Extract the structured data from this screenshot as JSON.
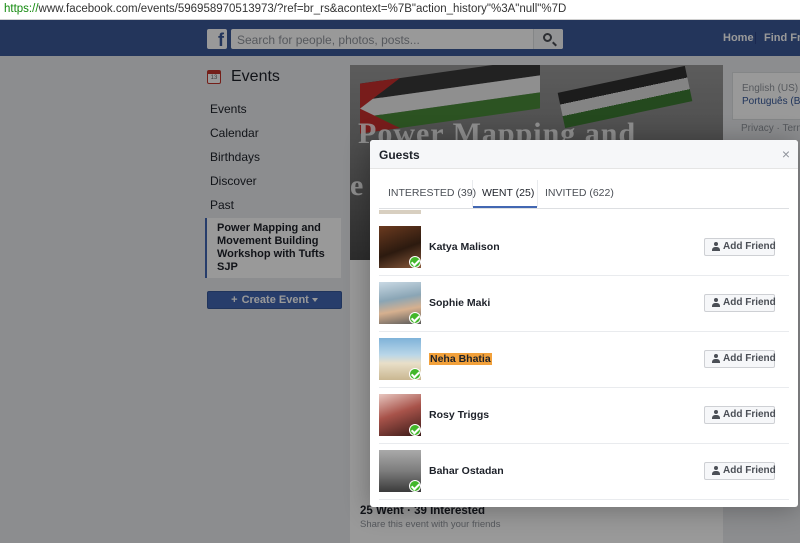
{
  "browser": {
    "url_scheme": "https://",
    "url_rest": "www.facebook.com/events/596958970513973/?ref=br_rs&acontext=%7B\"action_history\"%3A\"null\"%7D"
  },
  "topbar": {
    "logo": "f",
    "search_placeholder": "Search for people, photos, posts...",
    "home": "Home",
    "find_friends": "Find Frie"
  },
  "leftnav": {
    "title": "Events",
    "calendar_icon_day": "13",
    "items": [
      "Events",
      "Calendar",
      "Birthdays",
      "Discover",
      "Past"
    ],
    "active_lines": [
      "Power Mapping and",
      "Movement Building",
      "Workshop with Tufts",
      "SJP"
    ],
    "create_button": "Create Event"
  },
  "event": {
    "cover_line1": "Power Mapping and",
    "cover_line2": "e",
    "went_interested": "25 Went · 39 Interested",
    "share_text": "Share this event with your friends"
  },
  "rightrail": {
    "lang1": "English (US)",
    "lang2": "Português (Bra",
    "footer": "Privacy · Terms"
  },
  "dialog": {
    "title": "Guests",
    "close": "×",
    "tabs": [
      "INTERESTED (39)",
      "WENT (25)",
      "INVITED (622)"
    ],
    "active_tab": "WENT (25)",
    "add_friend_label": "Add Friend",
    "guests": [
      {
        "name": "Katya Malison",
        "highlighted": false
      },
      {
        "name": "Sophie Maki",
        "highlighted": false
      },
      {
        "name": "Neha Bhatia",
        "highlighted": true
      },
      {
        "name": "Rosy Triggs",
        "highlighted": false
      },
      {
        "name": "Bahar Ostadan",
        "highlighted": false
      }
    ]
  },
  "colors": {
    "fb_blue": "#3b5998",
    "button_blue": "#4267b2",
    "highlight": "#f2a13b",
    "went_check": "#42b72a"
  }
}
